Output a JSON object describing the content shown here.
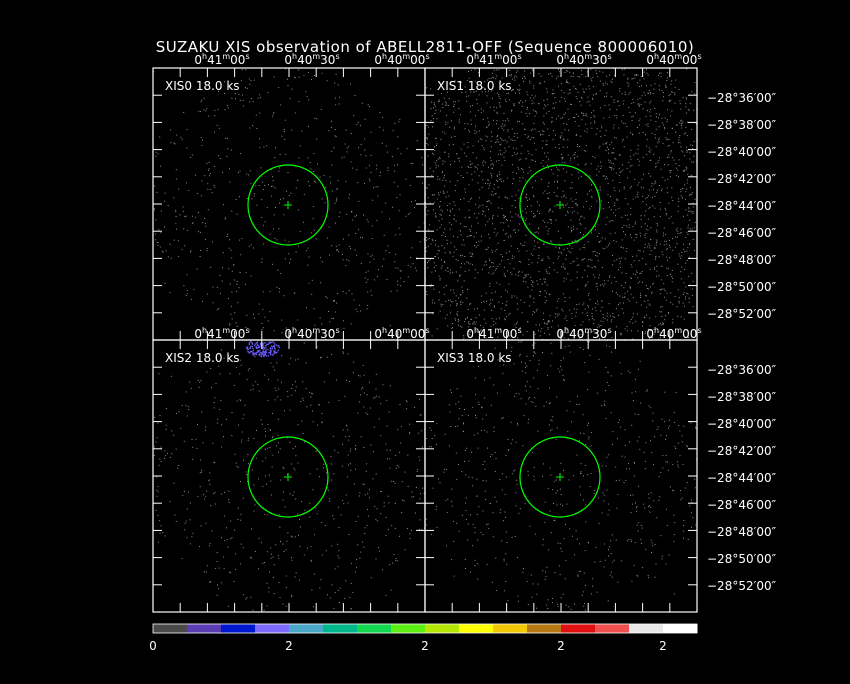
{
  "title": "SUZAKU XIS observation of ABELL2811-OFF  (Sequence 800006010)",
  "colors": {
    "background": "#000000",
    "frame": "#ffffff",
    "circle": "#00ff00",
    "marker": "#00ff00",
    "dots": "#8f8f8f",
    "blob": "#6a5cff"
  },
  "ra_ticks": [
    {
      "h": "0",
      "m": "41",
      "s": "00"
    },
    {
      "h": "0",
      "m": "40",
      "s": "30"
    },
    {
      "h": "0",
      "m": "40",
      "s": "00"
    }
  ],
  "dec_ticks": [
    "−28°36′00″",
    "−28°38′00″",
    "−28°40′00″",
    "−28°42′00″",
    "−28°44′00″",
    "−28°46′00″",
    "−28°48′00″",
    "−28°50′00″",
    "−28°52′00″"
  ],
  "panels": [
    {
      "label": "XIS0  18.0 ks",
      "density": "low"
    },
    {
      "label": "XIS1  18.0 ks",
      "density": "high"
    },
    {
      "label": "XIS2  18.0 ks",
      "density": "low"
    },
    {
      "label": "XIS3  18.0 ks",
      "density": "low"
    }
  ],
  "colorbar": {
    "segments": [
      "#4a4a4a",
      "#5a3cb4",
      "#0018d0",
      "#7b6cff",
      "#4aa8c8",
      "#00b88c",
      "#14d850",
      "#5cf014",
      "#b4e800",
      "#ffff00",
      "#f4c800",
      "#b87814",
      "#e01010",
      "#f05050",
      "#e8e8e8",
      "#ffffff"
    ],
    "labels": [
      "0",
      "2",
      "2",
      "2",
      "2"
    ]
  }
}
